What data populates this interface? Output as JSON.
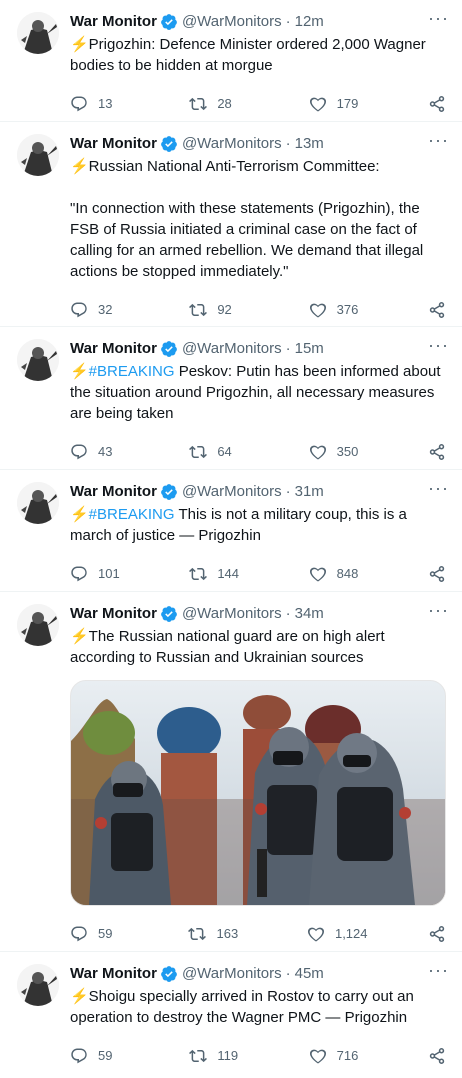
{
  "tweets": [
    {
      "author": "War Monitor",
      "handle": "@WarMonitors",
      "separator": "·",
      "time": "12m",
      "text": "⚡Prigozhin: Defence Minister ordered 2,000 Wagner bodies to be hidden at morgue",
      "replies": "13",
      "retweets": "28",
      "likes": "179"
    },
    {
      "author": "War Monitor",
      "handle": "@WarMonitors",
      "separator": "·",
      "time": "13m",
      "text": "⚡Russian National Anti-Terrorism Committee:\n\n\"In connection with these statements (Prigozhin), the FSB of Russia initiated a criminal case on the fact of calling for an armed rebellion. We demand that illegal actions be stopped immediately.\"",
      "replies": "32",
      "retweets": "92",
      "likes": "376"
    },
    {
      "author": "War Monitor",
      "handle": "@WarMonitors",
      "separator": "·",
      "time": "15m",
      "hashtag": "⚡#BREAKING",
      "text": " Peskov: Putin has been informed about the situation around Prigozhin, all necessary measures are being taken",
      "replies": "43",
      "retweets": "64",
      "likes": "350"
    },
    {
      "author": "War Monitor",
      "handle": "@WarMonitors",
      "separator": "·",
      "time": "31m",
      "hashtag": "⚡#BREAKING",
      "text": " This is not a military coup, this is a march of justice — Prigozhin",
      "replies": "101",
      "retweets": "144",
      "likes": "848"
    },
    {
      "author": "War Monitor",
      "handle": "@WarMonitors",
      "separator": "·",
      "time": "34m",
      "text": "⚡The Russian national guard are on high alert according to Russian and Ukrainian sources",
      "replies": "59",
      "retweets": "163",
      "likes": "1,124"
    },
    {
      "author": "War Monitor",
      "handle": "@WarMonitors",
      "separator": "·",
      "time": "45m",
      "text": "⚡Shoigu specially arrived in Rostov to carry out an operation to destroy the Wagner PMC — Prigozhin",
      "replies": "59",
      "retweets": "119",
      "likes": "716"
    }
  ],
  "icons": {
    "verified": "verified-badge-icon",
    "more": "more-options-icon",
    "reply": "reply-icon",
    "retweet": "retweet-icon",
    "like": "heart-icon",
    "share": "share-icon"
  },
  "colors": {
    "text": "#0f1419",
    "muted": "#536471",
    "link": "#1d9bf0",
    "verified": "#1d9bf0",
    "divider": "#eff3f4"
  }
}
